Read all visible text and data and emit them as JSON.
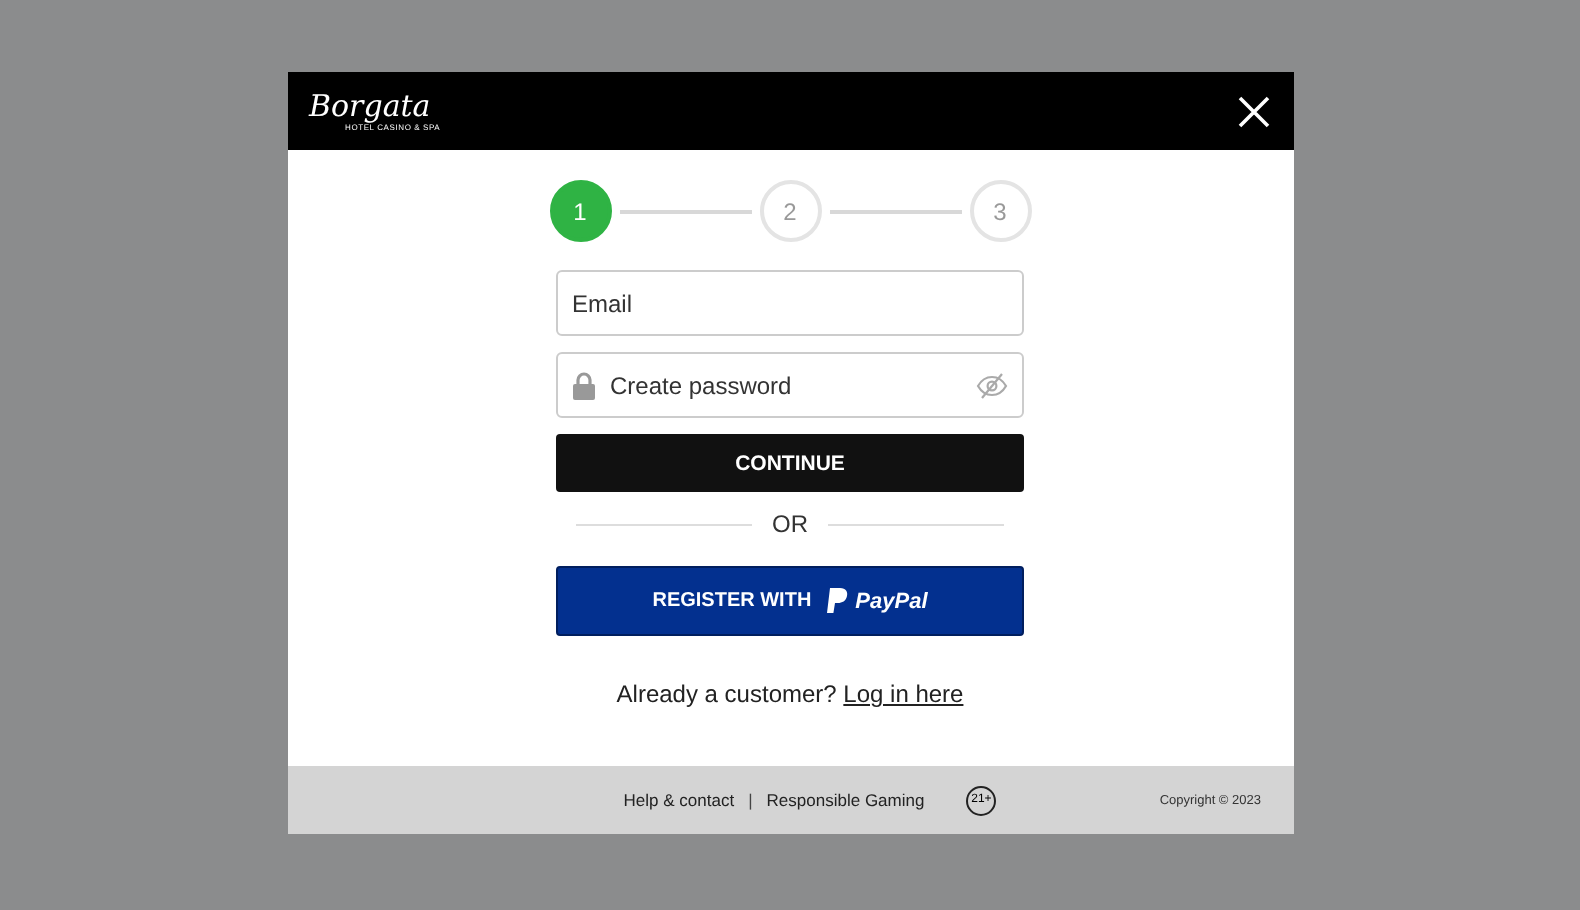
{
  "header": {
    "logo": "Borgata",
    "logo_tagline": "HOTEL CASINO & SPA"
  },
  "steps": [
    {
      "label": "1",
      "selected": true
    },
    {
      "label": "2",
      "selected": false
    },
    {
      "label": "3",
      "selected": false
    }
  ],
  "form": {
    "email": {
      "placeholder": "Email"
    },
    "password": {
      "placeholder": "Create password"
    },
    "continue": "CONTINUE",
    "separator": "OR",
    "paypal": {
      "prefix": "REGISTER WITH",
      "brand": "PayPal"
    }
  },
  "login": {
    "text": "Already a customer?",
    "link": "Log in here"
  },
  "footer": {
    "links": [
      "Help & contact",
      "Responsible Gaming"
    ],
    "separator": "|",
    "age_badge": "21+",
    "copyright": "Copyright © 2023"
  }
}
